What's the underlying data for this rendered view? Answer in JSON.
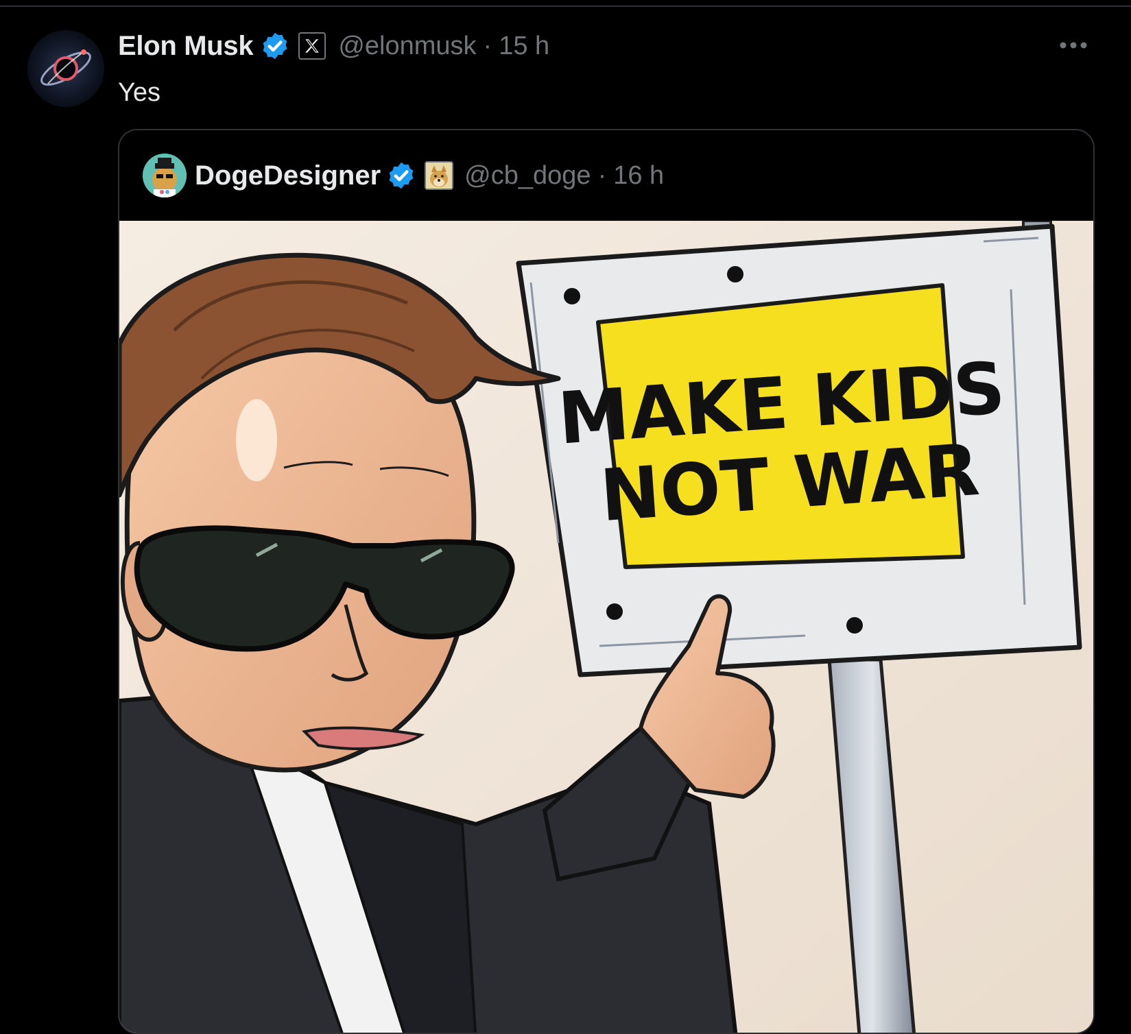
{
  "post": {
    "author": {
      "display_name": "Elon Musk",
      "handle": "@elonmusk",
      "verified_icon": "verified-badge-icon",
      "affiliate_icon": "x-logo-icon"
    },
    "separator": "·",
    "time": "15 h",
    "text": "Yes",
    "more_icon": "more-horizontal-icon",
    "colors": {
      "background": "#000000",
      "primary_text": "#e7e9ea",
      "secondary_text": "#71767b",
      "verified": "#1d9bf0",
      "border": "#2f3336"
    }
  },
  "quoted_post": {
    "author": {
      "display_name": "DogeDesigner",
      "handle": "@cb_doge",
      "verified_icon": "verified-badge-icon",
      "affiliate_icon": "doge-icon"
    },
    "separator": "·",
    "time": "16 h",
    "image": {
      "sign_line1": "MAKE KIDS",
      "sign_line2": "NOT WAR"
    }
  }
}
